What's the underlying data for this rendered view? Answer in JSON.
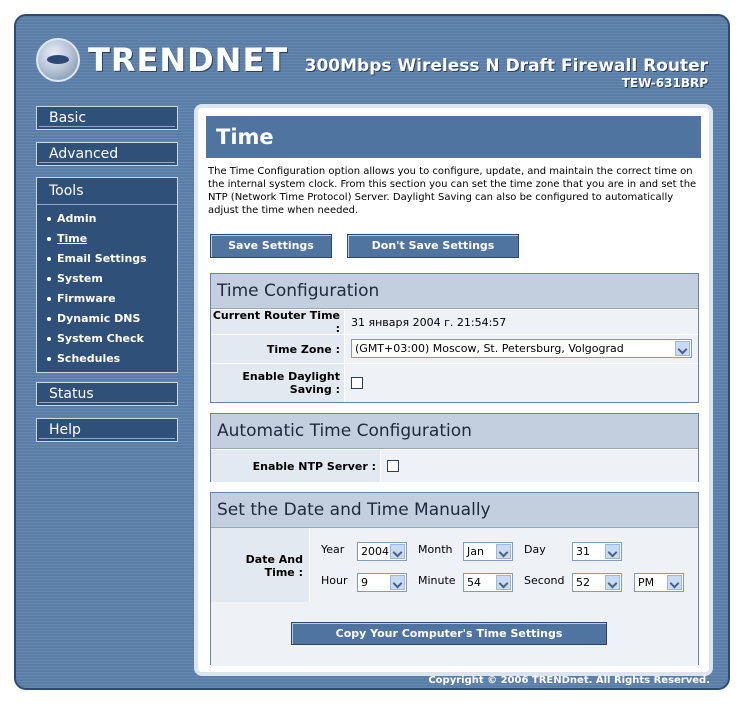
{
  "brand": {
    "logo_text": "TRENDNET",
    "product_title": "300Mbps Wireless N Draft Firewall Router",
    "model": "TEW-631BRP"
  },
  "nav": {
    "basic": "Basic",
    "advanced": "Advanced",
    "tools": "Tools",
    "tools_items": [
      "Admin",
      "Time",
      "Email Settings",
      "System",
      "Firmware",
      "Dynamic DNS",
      "System Check",
      "Schedules"
    ],
    "active_item": "Time",
    "status": "Status",
    "help": "Help"
  },
  "page": {
    "title": "Time",
    "intro": "The Time Configuration option allows you to configure, update, and maintain the correct time on the internal system clock. From this section you can set the time zone that you are in and set the NTP (Network Time Protocol) Server. Daylight Saving can also be configured to automatically adjust the time when needed.",
    "save_button": "Save Settings",
    "dont_save_button": "Don't Save Settings"
  },
  "time_config": {
    "heading": "Time Configuration",
    "current_time_label": "Current Router Time :",
    "current_time_value": "31 января 2004 г. 21:54:57",
    "timezone_label": "Time Zone :",
    "timezone_value": "(GMT+03:00) Moscow, St. Petersburg, Volgograd",
    "daylight_label": "Enable Daylight Saving :",
    "daylight_checked": false
  },
  "auto_config": {
    "heading": "Automatic Time Configuration",
    "ntp_label": "Enable NTP Server :",
    "ntp_checked": false
  },
  "manual": {
    "heading": "Set the Date and Time Manually",
    "date_time_label": "Date And Time :",
    "year_label": "Year",
    "year_value": "2004",
    "month_label": "Month",
    "month_value": "Jan",
    "day_label": "Day",
    "day_value": "31",
    "hour_label": "Hour",
    "hour_value": "9",
    "minute_label": "Minute",
    "minute_value": "54",
    "second_label": "Second",
    "second_value": "52",
    "ampm_value": "PM",
    "copy_button": "Copy Your Computer's Time Settings"
  },
  "footer": {
    "copyright": "Copyright © 2006 TRENDnet. All Rights Reserved."
  }
}
